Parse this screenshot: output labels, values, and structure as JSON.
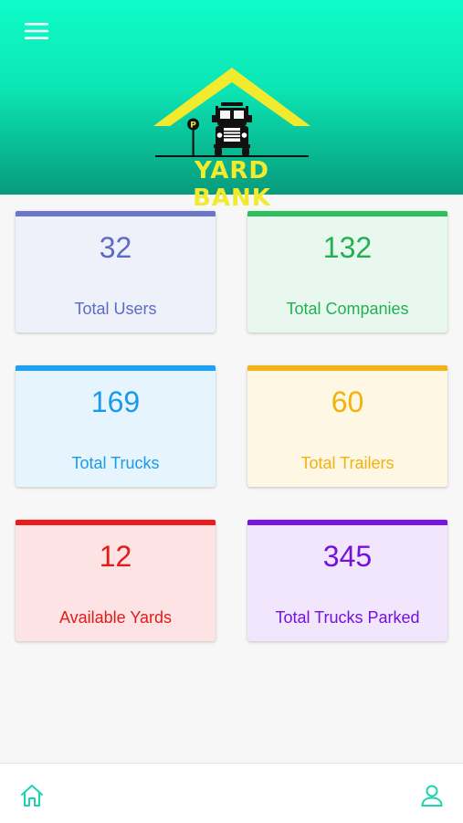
{
  "app": {
    "brand": "YARD BANK"
  },
  "header": {
    "menu_icon": "hamburger-menu-icon",
    "logo_icon": "truck-parking-logo-icon",
    "logo_colors": {
      "roof": "#f2ea2c",
      "truck": "#111111",
      "parking_sign": "#111111"
    },
    "gradient": [
      "#0ffcc8",
      "#079b7c"
    ]
  },
  "stats": [
    {
      "value": "32",
      "label": "Total Users",
      "accent": "#6b76c9",
      "background": "#eef0fa",
      "text_color": "#5d6bc4"
    },
    {
      "value": "132",
      "label": "Total Companies",
      "accent": "#2cbf5c",
      "background": "#e8f8ee",
      "text_color": "#23b055"
    },
    {
      "value": "169",
      "label": "Total Trucks",
      "accent": "#1ea1f1",
      "background": "#e5f4fd",
      "text_color": "#1b9aea"
    },
    {
      "value": "60",
      "label": "Total Trailers",
      "accent": "#f0b418",
      "background": "#fdf7e3",
      "text_color": "#f2b20e"
    },
    {
      "value": "12",
      "label": "Available Yards",
      "accent": "#ee1a1a",
      "background": "#fde3e3",
      "text_color": "#e31b1b"
    },
    {
      "value": "345",
      "label": "Total Trucks Parked",
      "accent": "#7b12e4",
      "background": "#f1e6fc",
      "text_color": "#7411da"
    }
  ],
  "bottom_nav": {
    "home_icon": "home-icon",
    "profile_icon": "user-icon",
    "icon_color": "#1ad6b0"
  }
}
